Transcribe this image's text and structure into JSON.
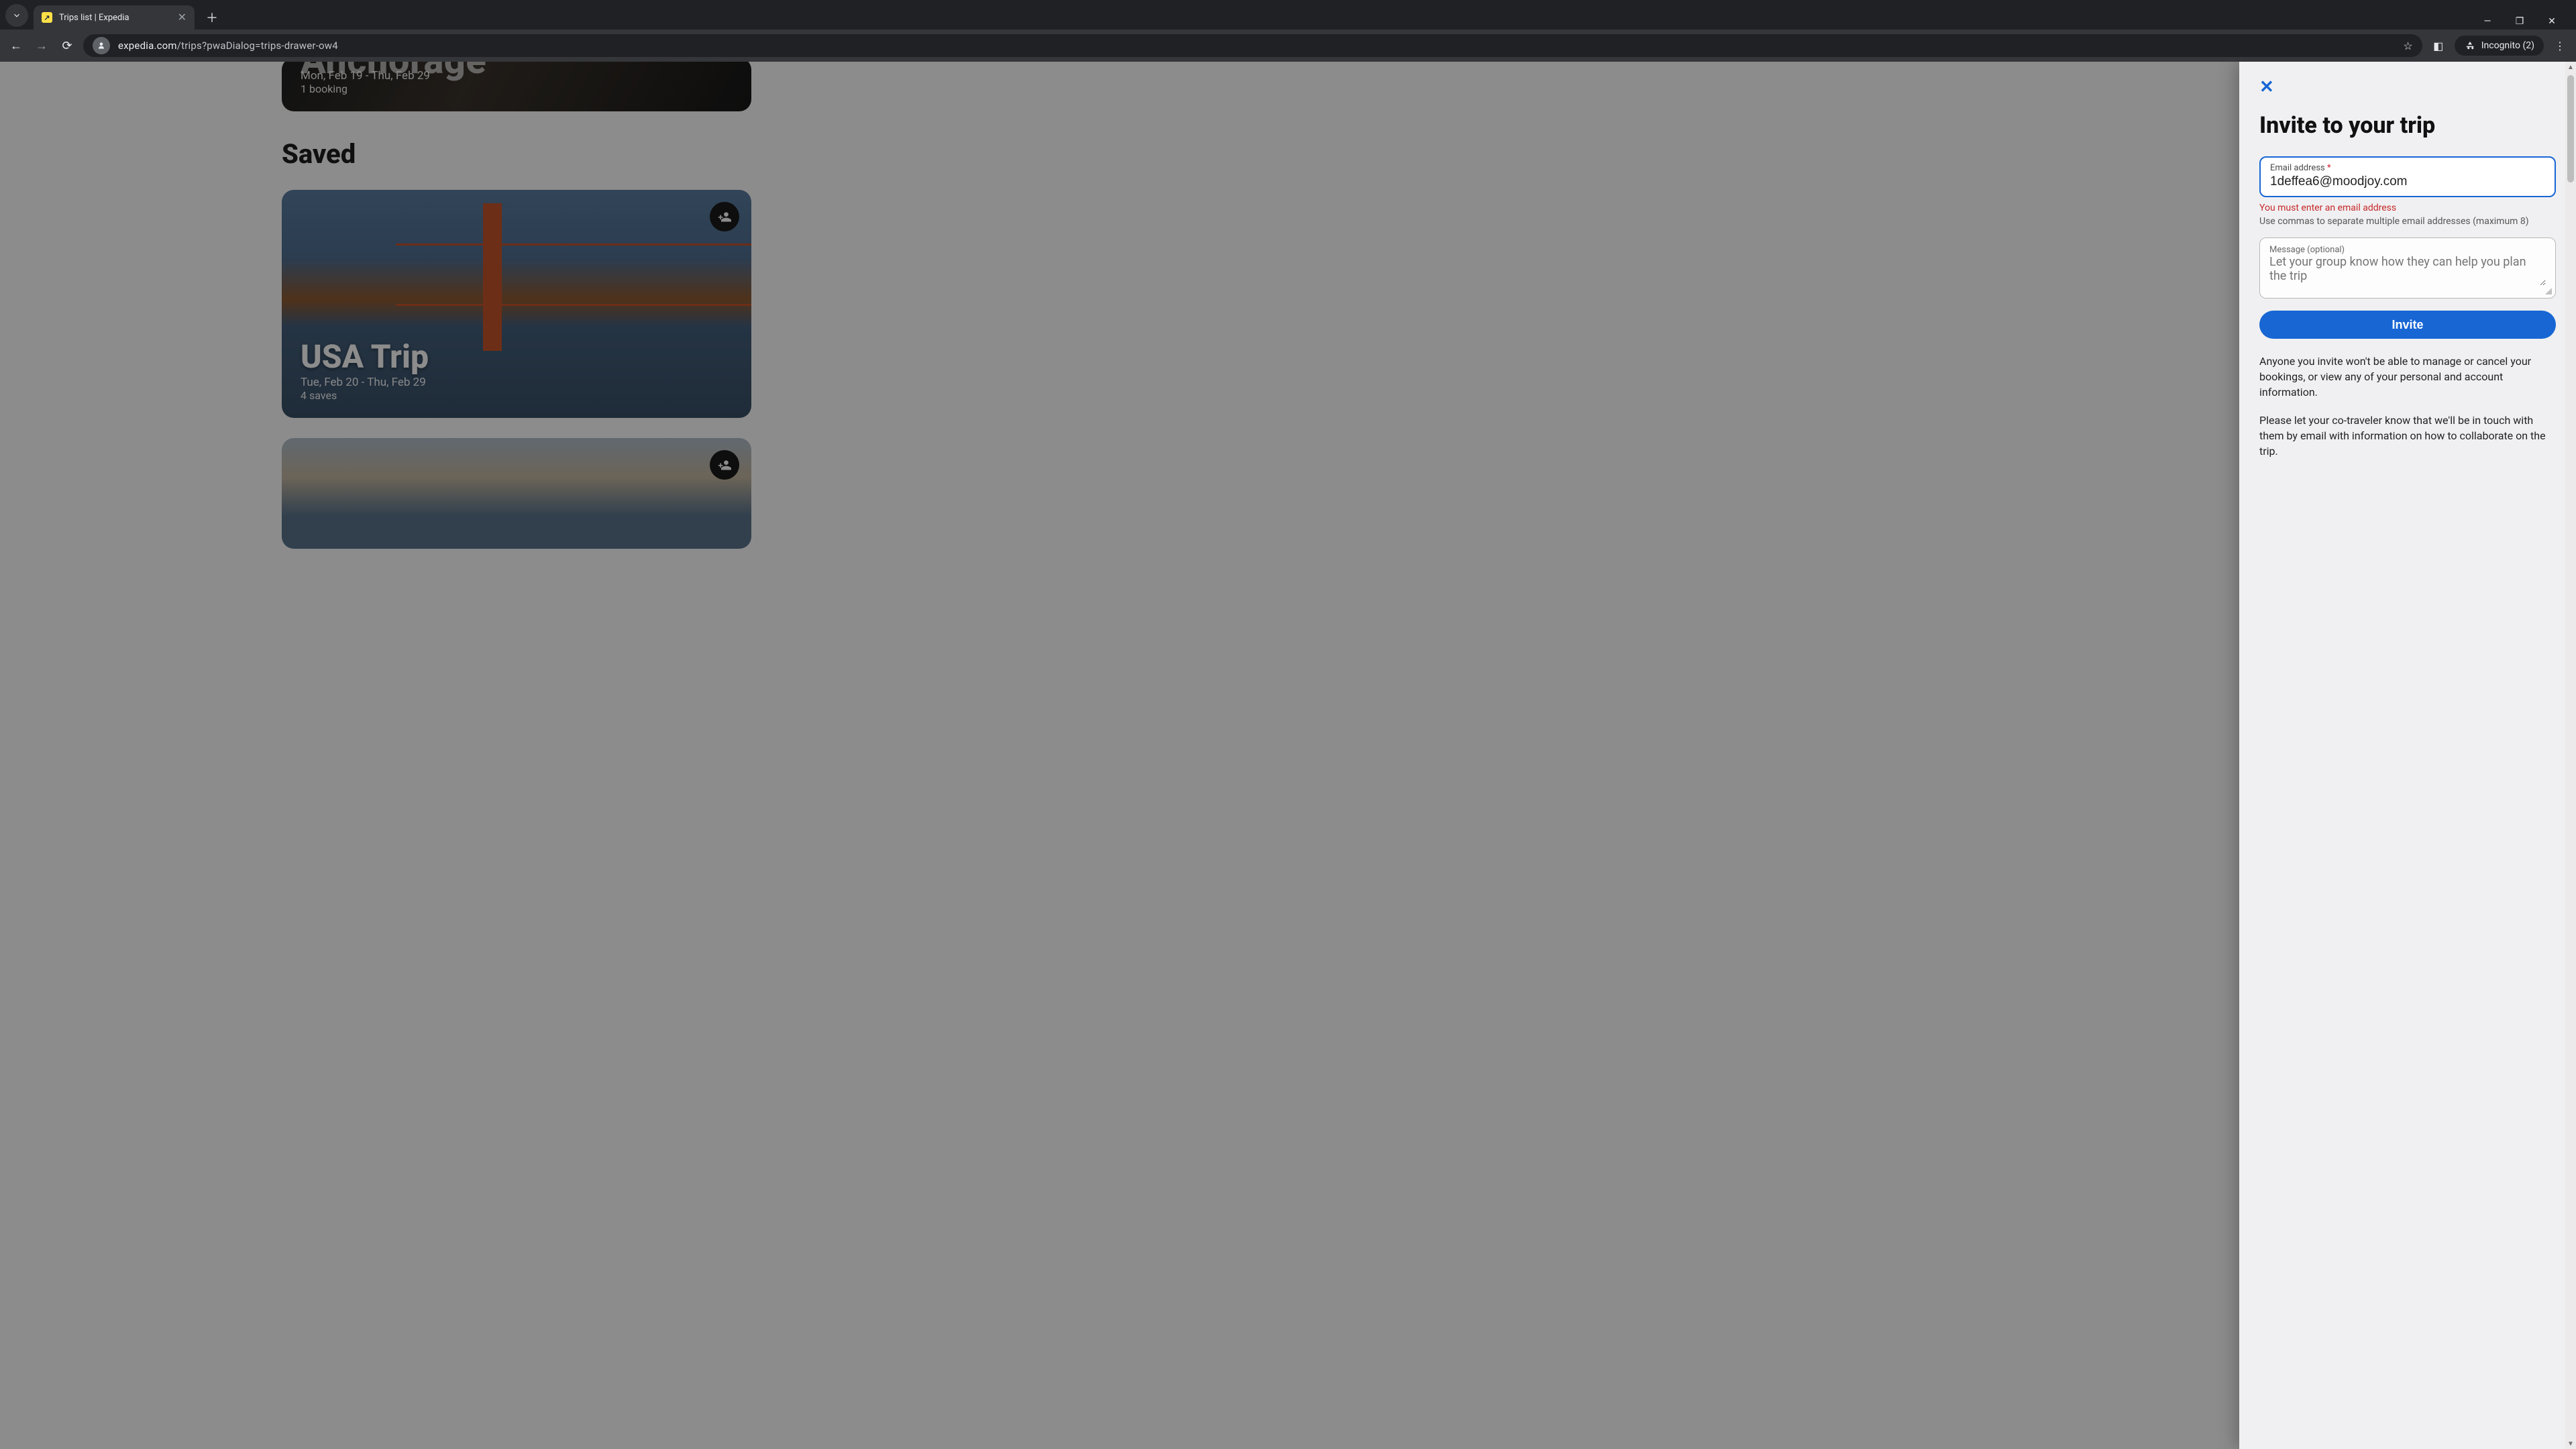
{
  "browser": {
    "tab_title": "Trips list | Expedia",
    "url_host": "expedia.com",
    "url_path": "/trips?pwaDialog=trips-drawer-ow4",
    "incognito_label": "Incognito (2)"
  },
  "page": {
    "anchorage": {
      "title": "Anchorage",
      "dates": "Mon, Feb 19 - Thu, Feb 29",
      "bookings": "1 booking"
    },
    "saved_heading": "Saved",
    "usa_trip": {
      "title": "USA Trip",
      "dates": "Tue, Feb 20 - Thu, Feb 29",
      "saves": "4 saves"
    }
  },
  "drawer": {
    "title": "Invite to your trip",
    "email_label": "Email address",
    "email_required": "*",
    "email_value": "1deffea6@moodjoy.com",
    "email_error": "You must enter an email address",
    "email_hint": "Use commas to separate multiple email addresses (maximum 8)",
    "message_label": "Message (optional)",
    "message_placeholder": "Let your group know how they can help you plan the trip",
    "invite_button": "Invite",
    "disclaimer1": "Anyone you invite won't be able to manage or cancel your bookings, or view any of your personal and account information.",
    "disclaimer2": "Please let your co-traveler know that we'll be in touch with them by email with information on how to collaborate on the trip."
  }
}
